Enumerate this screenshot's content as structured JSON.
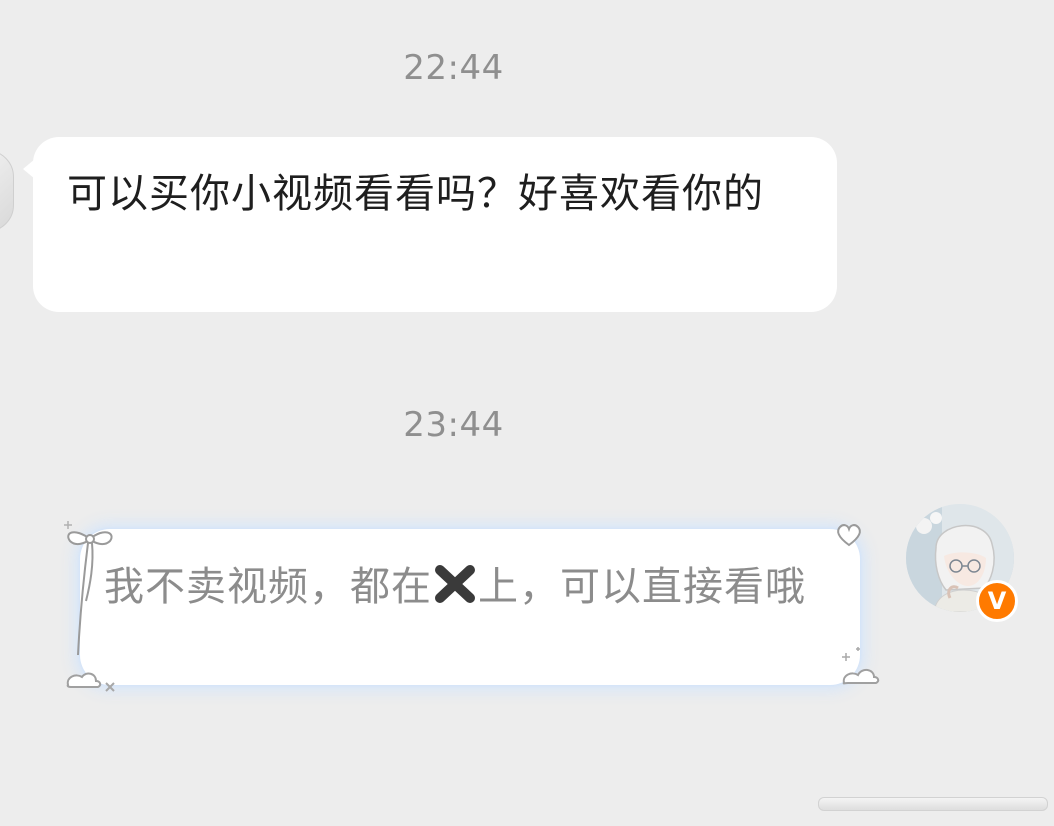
{
  "timestamps": [
    "22:44",
    "23:44"
  ],
  "incoming": {
    "text": "可以买你小视频看看吗？好喜欢看你的"
  },
  "outgoing": {
    "text_before_icon": "我不卖视频，都在",
    "icon": "cross-mark-icon",
    "text_after_icon": "上，可以直接看哦",
    "badge": "V"
  },
  "colors": {
    "background": "#ededed",
    "bubble": "#ffffff",
    "timestamp": "#8f8f8f",
    "incoming_text": "#1e1e1e",
    "outgoing_text": "#8c8c8c",
    "badge": "#ff7a00",
    "glow": "#d6e6fa"
  }
}
